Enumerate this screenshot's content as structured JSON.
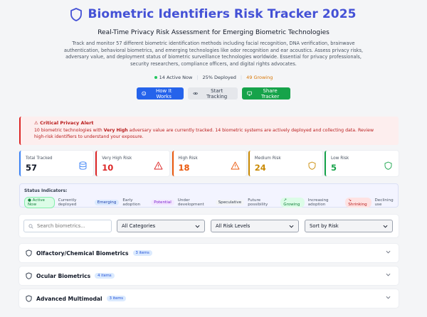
{
  "header": {
    "title": "Biometric Identifiers Risk Tracker 2025",
    "subtitle": "Real-Time Privacy Risk Assessment for Emerging Biometric Technologies",
    "description": "Track and monitor 57 different biometric identification methods including facial recognition, DNA verification, brainwave authentication, behavioral biometrics, and emerging technologies like odor recognition and ear acoustics. Assess privacy risks, adversary value, and deployment status of biometric surveillance technologies worldwide. Essential for privacy professionals, security researchers, compliance officers, and digital rights advocates."
  },
  "stats": {
    "active": "14 Active Now",
    "deployed": "25% Deployed",
    "growing": "49 Growing"
  },
  "buttons": {
    "how": "How It Works",
    "track": "Start Tracking",
    "share": "Share Tracker"
  },
  "alert": {
    "title": "⚠ Critical Privacy Alert",
    "pre": "10 biometric technologies with ",
    "strong": "Very High",
    "post": " adversary value are currently tracked. 14 biometric systems are actively deployed and collecting data. Review high-risk identifiers to understand your exposure."
  },
  "cards": [
    {
      "label": "Total Tracked",
      "value": "57",
      "color": "#3b82f6",
      "text_color": "#111827",
      "icon": "database-icon"
    },
    {
      "label": "Very High Risk",
      "value": "10",
      "color": "#dc2626",
      "text_color": "#dc2626",
      "icon": "warning-icon"
    },
    {
      "label": "High Risk",
      "value": "18",
      "color": "#ea580c",
      "text_color": "#ea580c",
      "icon": "warning-icon"
    },
    {
      "label": "Medium Risk",
      "value": "24",
      "color": "#ca8a04",
      "text_color": "#ca8a04",
      "icon": "shield-icon"
    },
    {
      "label": "Low Risk",
      "value": "5",
      "color": "#16a34a",
      "text_color": "#16a34a",
      "icon": "shield-icon"
    }
  ],
  "indicators": {
    "title": "Status Indicators:",
    "items": [
      {
        "pill": "● Active Now",
        "desc": "Currently deployed"
      },
      {
        "pill": "Emerging",
        "desc": "Early adoption"
      },
      {
        "pill": "Potential",
        "desc": "Under development"
      },
      {
        "pill": "Speculative",
        "desc": "Future possibility"
      },
      {
        "pill": "↗ Growing",
        "desc": "Increasing adoption"
      },
      {
        "pill": "↘ Shrinking",
        "desc": "Declining use"
      }
    ]
  },
  "filters": {
    "search_placeholder": "Search biometrics...",
    "category": "All Categories",
    "risk": "All Risk Levels",
    "sort": "Sort by Risk"
  },
  "categories": [
    {
      "name": "Olfactory/Chemical Biometrics",
      "count": "3 items"
    },
    {
      "name": "Ocular Biometrics",
      "count": "4 items"
    },
    {
      "name": "Advanced Multimodal",
      "count": "3 items"
    }
  ],
  "colors": {
    "accent": "#4451d6",
    "primary": "#2563eb",
    "success": "#16a34a",
    "danger": "#dc2626"
  }
}
